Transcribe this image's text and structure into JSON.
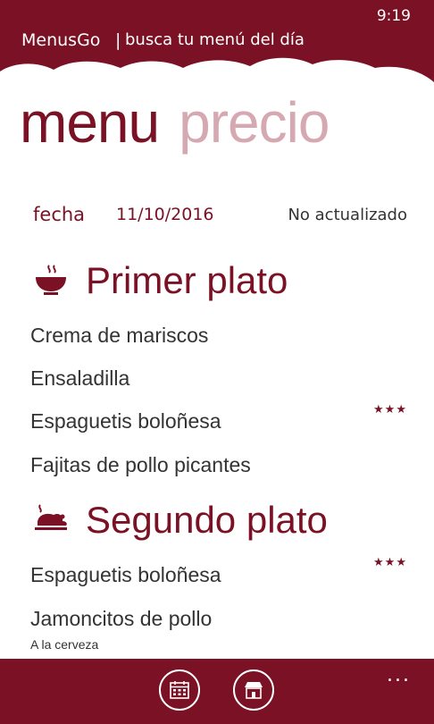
{
  "status": {
    "time": "9:19"
  },
  "header": {
    "app_title": "MenusGo",
    "separator": "|",
    "subtitle": "busca tu menú del día"
  },
  "pivot": {
    "items": [
      {
        "label": "menu",
        "active": true
      },
      {
        "label": "precio",
        "active": false
      }
    ]
  },
  "info": {
    "fecha_label": "fecha",
    "fecha_value": "11/10/2016",
    "status": "No actualizado"
  },
  "sections": [
    {
      "title": "Primer plato",
      "icon": "bowl-icon",
      "dishes": [
        {
          "name": "Crema de mariscos"
        },
        {
          "name": "Ensaladilla"
        },
        {
          "name": "Espaguetis boloñesa",
          "rating": "★★★"
        },
        {
          "name": "Fajitas de pollo picantes"
        }
      ]
    },
    {
      "title": "Segundo plato",
      "icon": "roast-chicken-icon",
      "dishes": [
        {
          "name": "Espaguetis boloñesa",
          "rating": "★★★"
        },
        {
          "name": "Jamoncitos de pollo",
          "note": "A la cerveza"
        }
      ]
    }
  ],
  "appbar": {
    "buttons": [
      {
        "icon": "calendar-icon"
      },
      {
        "icon": "store-icon"
      }
    ],
    "more": "..."
  },
  "colors": {
    "brand": "#7b1124",
    "pivot_inactive": "#d6a8b1",
    "text": "#333333"
  }
}
